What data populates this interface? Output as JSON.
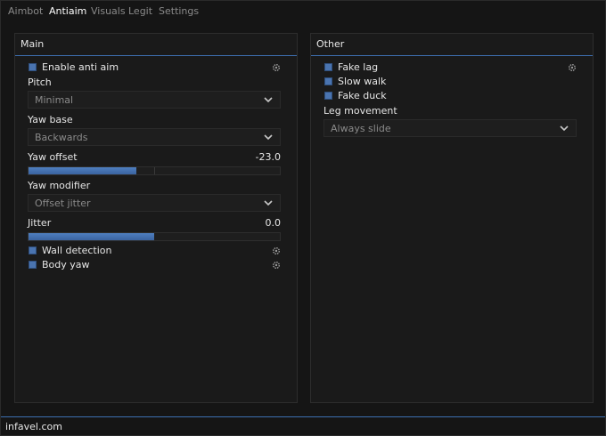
{
  "tabs": [
    "Aimbot",
    "Antiaim",
    "Visuals",
    "Legit",
    "Settings"
  ],
  "active_tab": "Antiaim",
  "main": {
    "title": "Main",
    "enable_anti_aim": "Enable anti aim",
    "pitch": {
      "label": "Pitch",
      "value": "Minimal"
    },
    "yaw_base": {
      "label": "Yaw base",
      "value": "Backwards"
    },
    "yaw_offset": {
      "label": "Yaw offset",
      "value": "-23.0",
      "fraction": 0.43
    },
    "yaw_modifier": {
      "label": "Yaw modifier",
      "value": "Offset jitter"
    },
    "jitter": {
      "label": "Jitter",
      "value": "0.0",
      "fraction": 0.5
    },
    "wall_detection": "Wall detection",
    "body_yaw": "Body yaw"
  },
  "other": {
    "title": "Other",
    "fake_lag": "Fake lag",
    "slow_walk": "Slow walk",
    "fake_duck": "Fake duck",
    "leg_movement": {
      "label": "Leg movement",
      "value": "Always slide"
    }
  },
  "footer": {
    "text": "infavel.com"
  },
  "colors": {
    "accent": "#4a74b0",
    "background": "#151515"
  }
}
